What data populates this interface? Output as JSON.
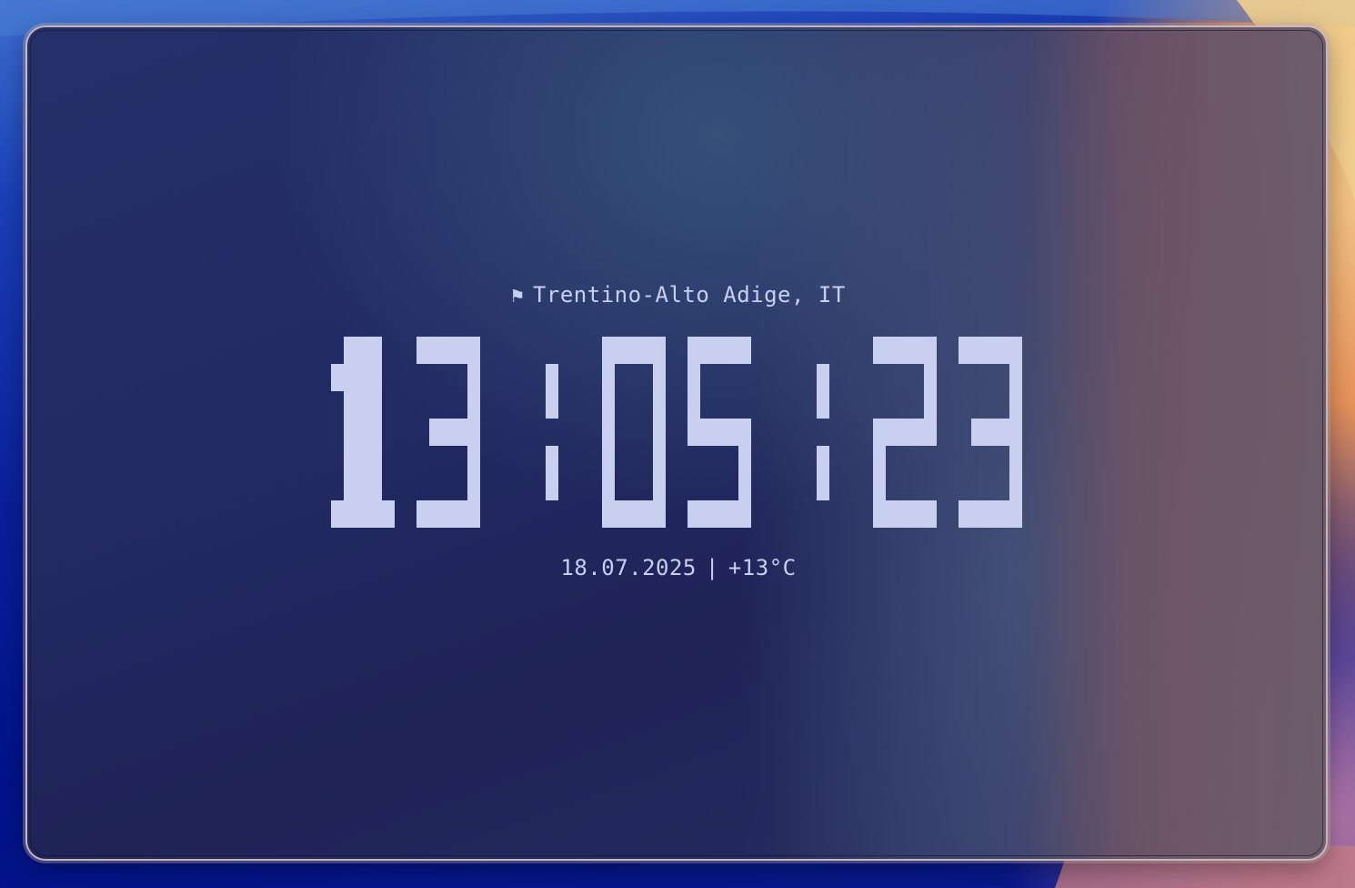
{
  "clock_widget": {
    "location_icon": "flag-icon",
    "location_glyph": "⚑",
    "location": "Trentino-Alto Adige, IT",
    "time": "13:05:23",
    "date": "18.07.2025",
    "separator": "|",
    "temperature": "+13°C"
  },
  "colors": {
    "digit": "#c9d0ef",
    "window_bg": "#222a62",
    "window_border": "#e1cdc8"
  }
}
